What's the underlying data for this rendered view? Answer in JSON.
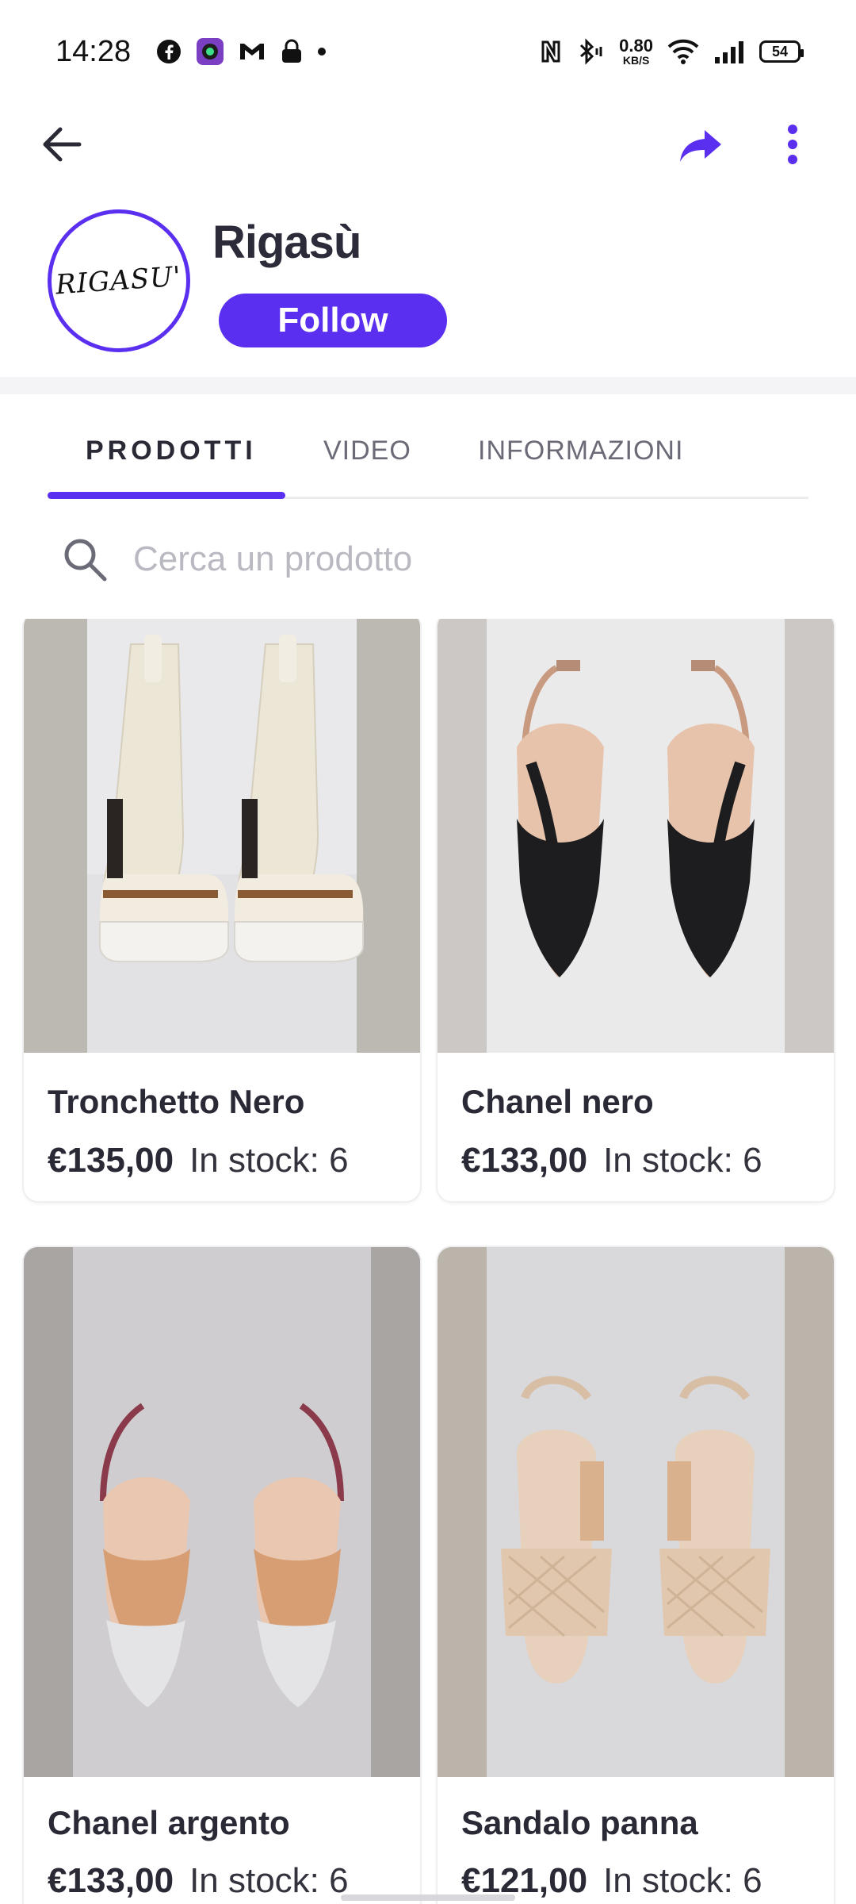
{
  "status_bar": {
    "time": "14:28",
    "net_speed_value": "0.80",
    "net_speed_unit": "KB/S",
    "battery": "54",
    "icons": [
      "facebook-icon",
      "camera-app-icon",
      "gmail-icon",
      "lock-icon",
      "dot-icon",
      "nfc-icon",
      "bluetooth-icon",
      "wifi-icon",
      "signal-icon",
      "battery-icon"
    ]
  },
  "app_bar": {
    "icons": [
      "back-arrow-icon",
      "share-icon",
      "more-vertical-icon"
    ]
  },
  "shop": {
    "logo_text": "RIGASU'",
    "name": "Rigasù",
    "follow_label": "Follow"
  },
  "tabs": [
    {
      "label": "PRODOTTI",
      "active": true
    },
    {
      "label": "VIDEO",
      "active": false
    },
    {
      "label": "INFORMAZIONI",
      "active": false
    }
  ],
  "search": {
    "placeholder": "Cerca un prodotto"
  },
  "products": [
    {
      "title": "Tronchetto Nero",
      "price": "€135,00",
      "stock": "In stock: 6"
    },
    {
      "title": "Chanel nero",
      "price": "€133,00",
      "stock": "In stock: 6"
    },
    {
      "title": "Chanel argento",
      "price": "€133,00",
      "stock": "In stock: 6"
    },
    {
      "title": "Sandalo panna",
      "price": "€121,00",
      "stock": "In stock: 6"
    }
  ],
  "colors": {
    "accent": "#5a2ff0",
    "text_dark": "#2a2a36",
    "tab_inactive": "#6b6b78",
    "placeholder": "#b9b9c2"
  }
}
